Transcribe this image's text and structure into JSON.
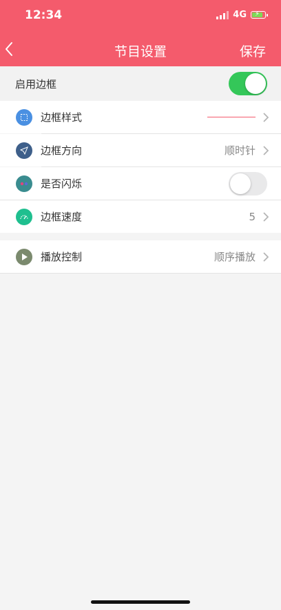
{
  "status_bar": {
    "time": "12:34",
    "network": "4G"
  },
  "nav": {
    "title": "节目设置",
    "save": "保存"
  },
  "enable_border": {
    "label": "启用边框",
    "enabled": true
  },
  "settings": [
    {
      "label": "边框样式",
      "value": "",
      "icon": "border-style-icon",
      "color": "#4a90e2"
    },
    {
      "label": "边框方向",
      "value": "顺时针",
      "icon": "direction-arrow-icon",
      "color": "#3e5f8a"
    },
    {
      "label": "是否闪烁",
      "value": "",
      "icon": "blink-icon",
      "color": "#3a8c8f",
      "toggle": false
    },
    {
      "label": "边框速度",
      "value": "5",
      "icon": "speed-gauge-icon",
      "color": "#1fbf8f"
    }
  ],
  "playback": {
    "label": "播放控制",
    "value": "顺序播放",
    "icon": "play-icon",
    "color": "#7b8a6e"
  },
  "colors": {
    "header": "#f45b6c",
    "toggle_on": "#34c759",
    "accent_line": "#f45b6c"
  }
}
